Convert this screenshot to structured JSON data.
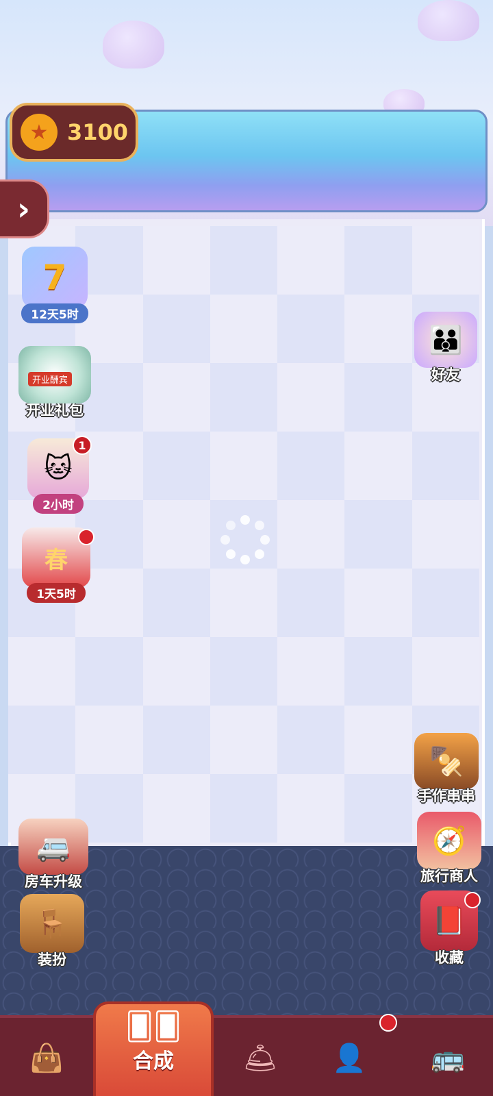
{
  "currency": {
    "amount": "3100",
    "icon": "star-coin-icon"
  },
  "expand_button": {
    "icon": "chevron-right-icon"
  },
  "left_events": [
    {
      "id": "seven-day",
      "icon": "seven-day-balloon-icon",
      "badge_text": "7",
      "timer": "12天5时"
    },
    {
      "id": "opening-gift",
      "icon": "opening-wreath-icon",
      "banner_text": "开业酬宾",
      "label": "开业礼包"
    },
    {
      "id": "cat-gift",
      "icon": "cat-gift-icon",
      "badge": "1",
      "timer": "2小时"
    },
    {
      "id": "spring",
      "icon": "spring-bunny-icon",
      "stamp": "春",
      "timer": "1天5时"
    }
  ],
  "right_actions": [
    {
      "id": "friends",
      "icon": "friends-icon",
      "label": "好友"
    },
    {
      "id": "skewers",
      "icon": "skewers-icon",
      "label": "手作串串"
    },
    {
      "id": "merchant",
      "icon": "merchant-stall-icon",
      "label": "旅行商人"
    },
    {
      "id": "collection",
      "icon": "collection-book-icon",
      "label": "收藏"
    }
  ],
  "bottom_left_actions": [
    {
      "id": "rv-upgrade",
      "icon": "rv-upgrade-icon",
      "label": "房车升级"
    },
    {
      "id": "decorate",
      "icon": "paint-roller-icon",
      "label": "装扮"
    }
  ],
  "nav": {
    "active_label": "合成",
    "items": [
      {
        "id": "bag",
        "icon": "shopping-bag-icon"
      },
      {
        "id": "merge",
        "icon": "cards-icon",
        "label": "合成"
      },
      {
        "id": "service",
        "icon": "service-bell-icon"
      },
      {
        "id": "profile",
        "icon": "profile-card-icon"
      },
      {
        "id": "bus",
        "icon": "bus-icon"
      }
    ]
  },
  "colors": {
    "nav_bg": "#6b2330",
    "nav_active": "#e65c3f",
    "coin_text": "#ffd46b",
    "board_light": "#ececf9",
    "board_dark": "#dfe3f7"
  }
}
